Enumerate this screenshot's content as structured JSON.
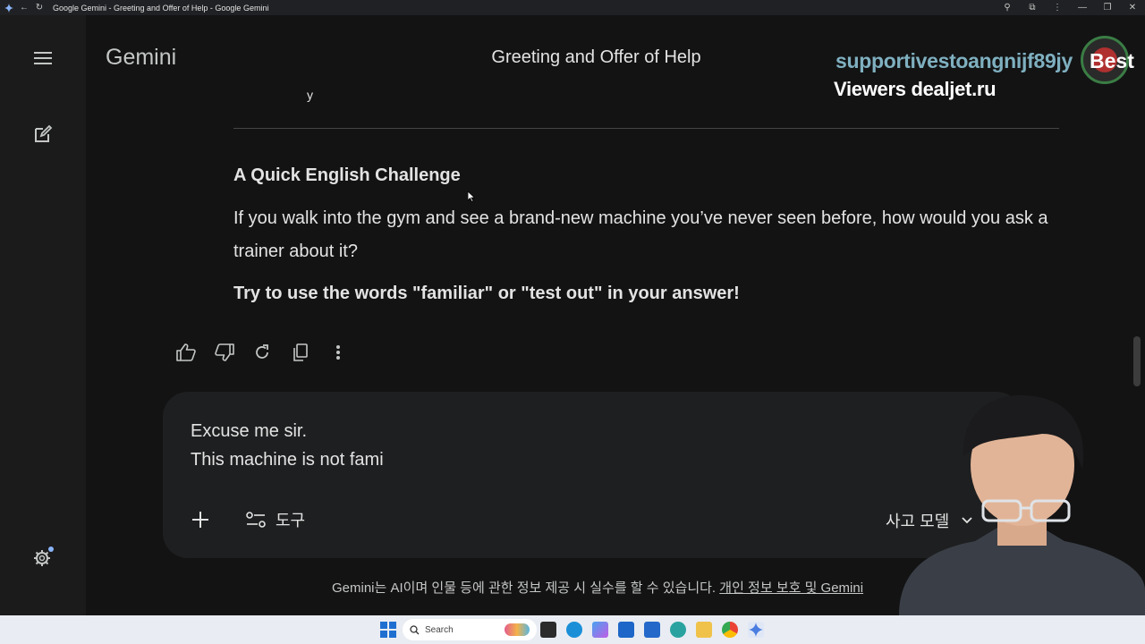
{
  "window": {
    "title": "Google Gemini - Greeting and Offer of Help - Google Gemini"
  },
  "header": {
    "brand": "Gemini",
    "conversation_title": "Greeting and Offer of Help"
  },
  "overlay": {
    "line1": "supportivestoangnijf89jy",
    "line1_suffix": "Best",
    "line2": "Viewers dealjet.ru"
  },
  "message": {
    "truncated_char": "y",
    "heading": "A Quick English Challenge",
    "body": "If you walk into the gym and see a brand-new machine you’ve never seen before, how would you ask a trainer about it?",
    "bold_line": "Try to use the words \"familiar\" or \"test out\" in your answer!"
  },
  "composer": {
    "line1": "Excuse me sir.",
    "line2": "This machine is not fami",
    "tools_label": "도구",
    "model_label": "사고 모델"
  },
  "disclaimer": {
    "text": "Gemini는 AI이며 인물 등에 관한 정보 제공 시 실수를 할 수 있습니다.",
    "link": "개인 정보 보호 및 Gemini"
  },
  "taskbar": {
    "search_label": "Search"
  },
  "colors": {
    "background": "#131314",
    "rail": "#1b1b1c",
    "input": "#1e1f20",
    "text": "#e3e3e3",
    "overlay_accent": "#7fb0c0"
  }
}
